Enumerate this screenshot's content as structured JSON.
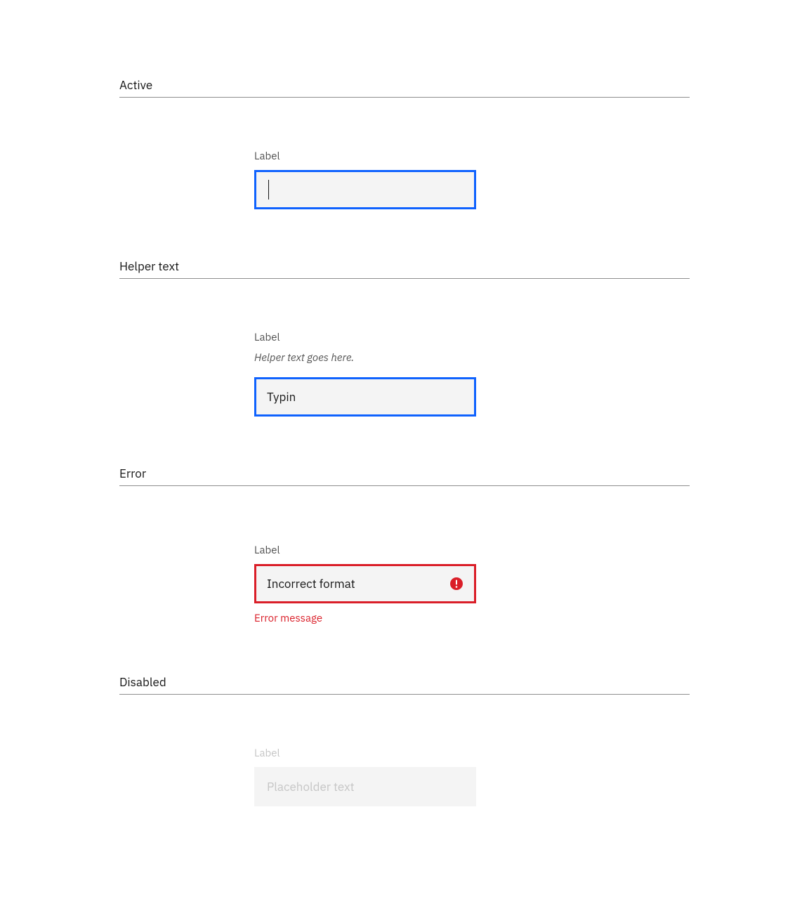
{
  "sections": {
    "active": {
      "title": "Active",
      "label": "Label",
      "value": ""
    },
    "helper": {
      "title": "Helper text",
      "label": "Label",
      "helper": "Helper text goes here.",
      "value": "Typin"
    },
    "error": {
      "title": "Error",
      "label": "Label",
      "value": "Incorrect format",
      "message": "Error message"
    },
    "disabled": {
      "title": "Disabled",
      "label": "Label",
      "placeholder": "Placeholder text"
    }
  },
  "colors": {
    "focus": "#0f62fe",
    "error": "#da1e28",
    "field_bg": "#f4f4f4",
    "text_secondary": "#525252",
    "disabled": "#c6c6c6"
  }
}
